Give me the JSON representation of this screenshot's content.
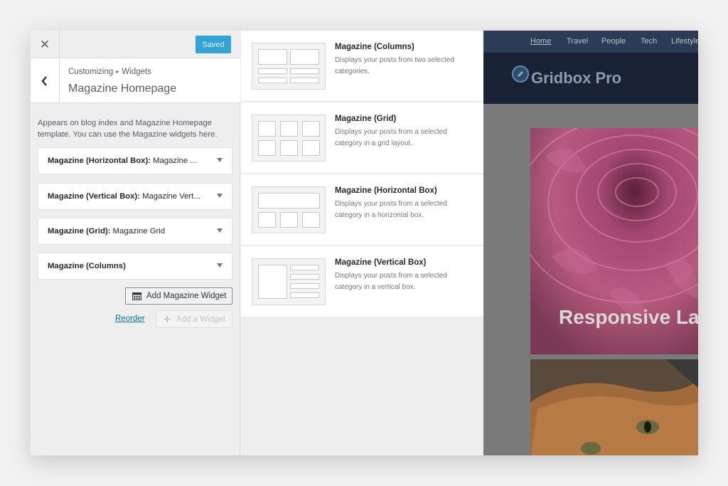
{
  "topbar": {
    "close_icon": "close-icon",
    "saved_label": "Saved",
    "saved_color": "#33a3d8"
  },
  "section": {
    "breadcrumb_root": "Customizing",
    "breadcrumb_child": "Widgets",
    "title": "Magazine Homepage",
    "description": "Appears on blog index and Magazine Homepage template. You can use the Magazine widgets here."
  },
  "widgets": [
    {
      "name": "Magazine (Horizontal Box):",
      "subtitle": "Magazine ..."
    },
    {
      "name": "Magazine (Vertical Box):",
      "subtitle": "Magazine Vert..."
    },
    {
      "name": "Magazine (Grid):",
      "subtitle": "Magazine Grid"
    },
    {
      "name": "Magazine (Columns)",
      "subtitle": ""
    }
  ],
  "actions": {
    "add_magazine_widget": "Add Magazine Widget",
    "reorder": "Reorder",
    "add_widget": "Add a Widget"
  },
  "available": [
    {
      "name": "Magazine (Columns)",
      "description": "Displays your posts from two selected categories."
    },
    {
      "name": "Magazine (Grid)",
      "description": "Displays your posts from a selected category in a grid layout."
    },
    {
      "name": "Magazine (Horizontal Box)",
      "description": "Displays your posts from a selected category in a horizontal box."
    },
    {
      "name": "Magazine (Vertical Box)",
      "description": "Displays your posts from a selected category in a vertical box."
    }
  ],
  "preview": {
    "nav": [
      "Home",
      "Travel",
      "People",
      "Tech",
      "Lifestyle"
    ],
    "site_title": "Gridbox Pro",
    "hero_text": "Responsive La"
  }
}
